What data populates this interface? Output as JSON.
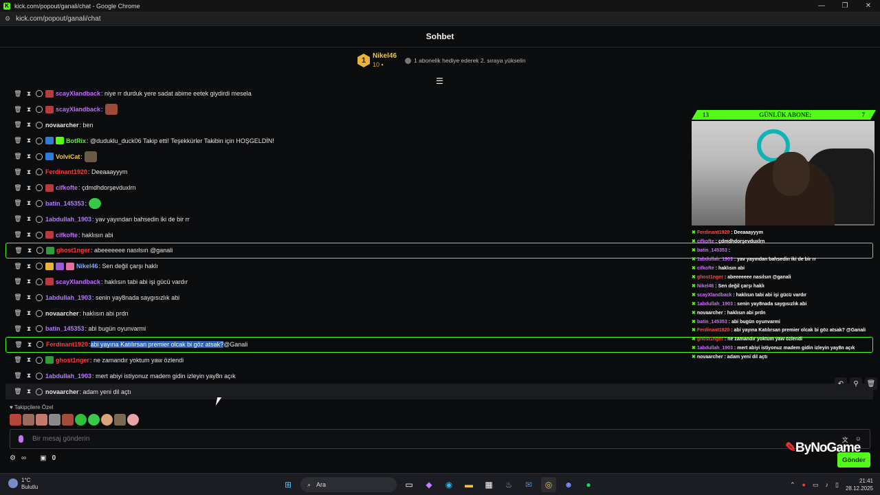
{
  "window": {
    "title": "kick.com/popout/ganali/chat - Google Chrome",
    "url": "kick.com/popout/ganali/chat"
  },
  "header": {
    "title": "Sohbet"
  },
  "leaderboard": {
    "rank": "1",
    "name": "Nikel46",
    "count": "10",
    "tip": "1 abonelik hediye ederek 2. sıraya yükselin"
  },
  "messages": [
    {
      "user": "scayXlandback",
      "color": "#c56dff",
      "text": ": niye rr durduk yere sadat abime eetek giydirdi mesela"
    },
    {
      "user": "scayXlandback",
      "color": "#c56dff",
      "text": ":"
    },
    {
      "user": "novaarcher",
      "color": "#e6e6e6",
      "text": ": ben"
    },
    {
      "user": "BotRix",
      "color": "#53fc18",
      "text": ": @duduklu_duck06 Takip etti! Teşekkürler Takibin için HOŞGELDİN!"
    },
    {
      "user": "VolviCat",
      "color": "#f2c84b",
      "text": ":"
    },
    {
      "user": "Ferdinant1920",
      "color": "#ff3b3b",
      "text": ": Deeaaayyym"
    },
    {
      "user": "cifkofte",
      "color": "#c56dff",
      "text": ": çdmdhdorşevduxlrn"
    },
    {
      "user": "batin_145353",
      "color": "#b77bff",
      "text": ":"
    },
    {
      "user": "1abdullah_1903",
      "color": "#b77bff",
      "text": ": yav yayından bahsedin iki de bir rr"
    },
    {
      "user": "cifkofte",
      "color": "#c56dff",
      "text": ": haklısın abi"
    },
    {
      "user": "ghost1nger",
      "color": "#ff3b3b",
      "text": ": abeeeeeee nasılsın @ganali"
    },
    {
      "user": "Nikel46",
      "color": "#7fa8ff",
      "text": ": Sen değil çarşı haklı"
    },
    {
      "user": "scayXlandback",
      "color": "#c56dff",
      "text": ": haklısın tabi abi işi gücü vardır"
    },
    {
      "user": "1abdullah_1903",
      "color": "#b77bff",
      "text": ": senin yay8nada saygısızlık abi"
    },
    {
      "user": "novaarcher",
      "color": "#e6e6e6",
      "text": ": haklısın abi prdn"
    },
    {
      "user": "batin_145353",
      "color": "#b77bff",
      "text": ": abi bugün oyunvarmi"
    },
    {
      "user": "Ferdinant1920",
      "color": "#ff3b3b",
      "text": ": ",
      "selected": "abi yayına Katılırsan premier olcak bi göz atsak?",
      "after": " @Ganali"
    },
    {
      "user": "ghost1nger",
      "color": "#ff3b3b",
      "text": ": ne zamandır yoktum yaw özlendi"
    },
    {
      "user": "1abdullah_1903",
      "color": "#b77bff",
      "text": ": mert abiyi istiyonuz madem gidin izleyin yay8n açık"
    },
    {
      "user": "novaarcher",
      "color": "#e6e6e6",
      "text": ": adam yeni dil açtı"
    }
  ],
  "overlay": {
    "left_count": "13",
    "title": "GÜNLÜK ABONE:",
    "right_count": "7",
    "chat": [
      {
        "user": "Ferdinant1920",
        "text": " : Deeaaayyym"
      },
      {
        "user": "cifkofte",
        "text": " : çdmdhdorşevduxlrn"
      },
      {
        "user": "batin_145353",
        "text": " :"
      },
      {
        "user": "1abdullah_1903",
        "text": " : yav yayından bahsedin iki de bir rr"
      },
      {
        "user": "cifkofte",
        "text": " : haklısın abi"
      },
      {
        "user": "ghost1nger",
        "text": " : abeeeeeee nasılsın @ganali"
      },
      {
        "user": "Nikel46",
        "text": " : Sen değil çarşı haklı"
      },
      {
        "user": "scayXlandback",
        "text": " : haklısın tabi abi işi gücü vardır"
      },
      {
        "user": "1abdullah_1903",
        "text": " : senin yay8nada saygısızlık abi"
      },
      {
        "user": "novaarcher",
        "text": " : haklısın abi prdn"
      },
      {
        "user": "batin_145353",
        "text": " : abi bugün oyunvarmi"
      },
      {
        "user": "Ferdinant1920",
        "text": " : abi yayına Katılırsan premier olcak bi göz atsak? @Ganali"
      },
      {
        "user": "ghost1nger",
        "text": " : ne zamandır yoktum yaw özlendi"
      },
      {
        "user": "1abdullah_1903",
        "text": " : mert abiyi istiyonuz madem gidin izleyin yay8n açık"
      },
      {
        "user": "novaarcher",
        "text": " : adam yeni dil açtı"
      }
    ]
  },
  "followers_label": "Takipçilere Özel",
  "input": {
    "placeholder": "Bir mesaj gönderin"
  },
  "bottom": {
    "count": "0",
    "send": "Gönder"
  },
  "watermark": "ByNoGame",
  "taskbar": {
    "temp": "1°C",
    "weather": "Bulutlu",
    "search": "Ara",
    "time": "21:41",
    "date": "28.12.2025"
  },
  "colors": {
    "accent": "#53fc18",
    "bg": "#0b0c0e",
    "selection": "#2e5fb0"
  }
}
